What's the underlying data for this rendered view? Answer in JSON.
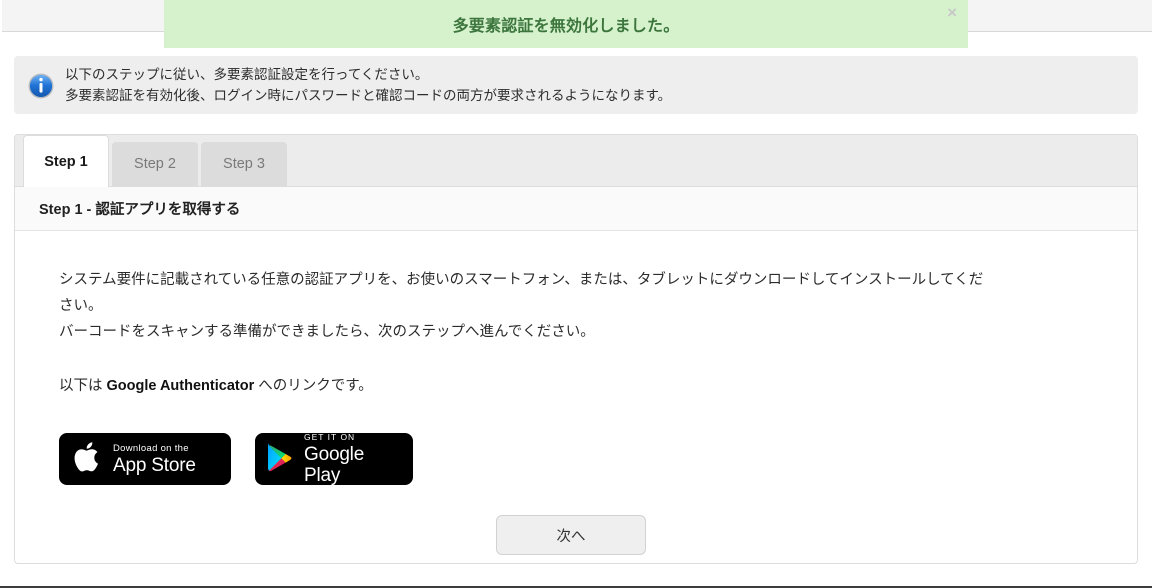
{
  "alert": {
    "message": "多要素認証を無効化しました。",
    "close_label": "×",
    "background_color": "#d6f2cd",
    "text_color": "#3c763d"
  },
  "info": {
    "icon": "info-circle-icon",
    "line1": "以下のステップに従い、多要素認証設定を行ってください。",
    "line2": "多要素認証を有効化後、ログイン時にパスワードと確認コードの両方が要求されるようになります。"
  },
  "tabs": [
    {
      "label": "Step 1",
      "active": true
    },
    {
      "label": "Step 2",
      "active": false
    },
    {
      "label": "Step 3",
      "active": false
    }
  ],
  "section": {
    "heading": "Step 1 - 認証アプリを取得する"
  },
  "body": {
    "paragraph1_line1": "システム要件に記載されている任意の認証アプリを、お使いのスマートフォン、または、タブレットにダウンロードしてインストールしてくだ",
    "paragraph1_line2": "さい。",
    "paragraph1_line3": "バーコードをスキャンする準備ができましたら、次のステップへ進んでください。",
    "paragraph2_prefix": "以下は ",
    "paragraph2_brand": "Google Authenticator",
    "paragraph2_suffix": " へのリンクです。"
  },
  "badges": {
    "apple": {
      "icon": "apple-logo-icon",
      "small_text": "Download on the",
      "big_text": "App Store"
    },
    "google": {
      "icon": "google-play-triangle-icon",
      "small_text": "GET IT ON",
      "big_text": "Google Play"
    }
  },
  "actions": {
    "next_label": "次へ"
  }
}
